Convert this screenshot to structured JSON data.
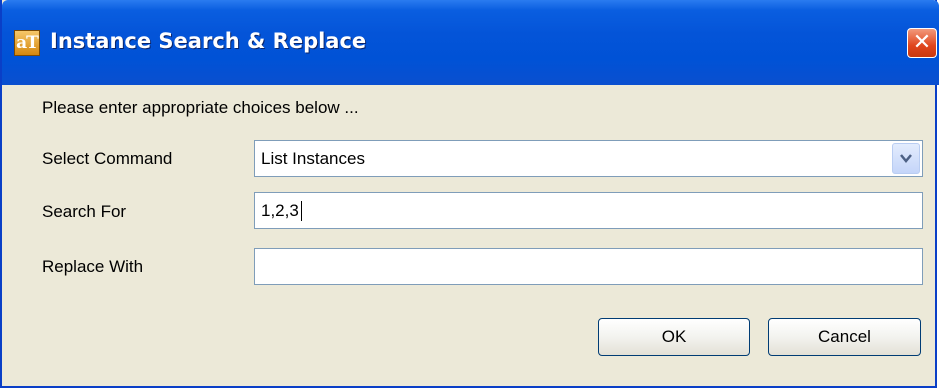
{
  "window": {
    "title": "Instance Search & Replace",
    "app_icon_text": "aT",
    "close_symbol": "✕"
  },
  "dialog": {
    "instruction": "Please enter appropriate choices below ...",
    "select_command": {
      "label": "Select Command",
      "value": "List Instances"
    },
    "search_for": {
      "label": "Search For",
      "value": "1,2,3"
    },
    "replace_with": {
      "label": "Replace With",
      "value": ""
    },
    "buttons": {
      "ok": "OK",
      "cancel": "Cancel"
    }
  },
  "colors": {
    "titlebar": "#0454d8",
    "dialog_bg": "#ece9d8",
    "close_button": "#e0451d"
  },
  "icons": [
    "app-icon",
    "close-icon",
    "chevron-down-icon"
  ]
}
